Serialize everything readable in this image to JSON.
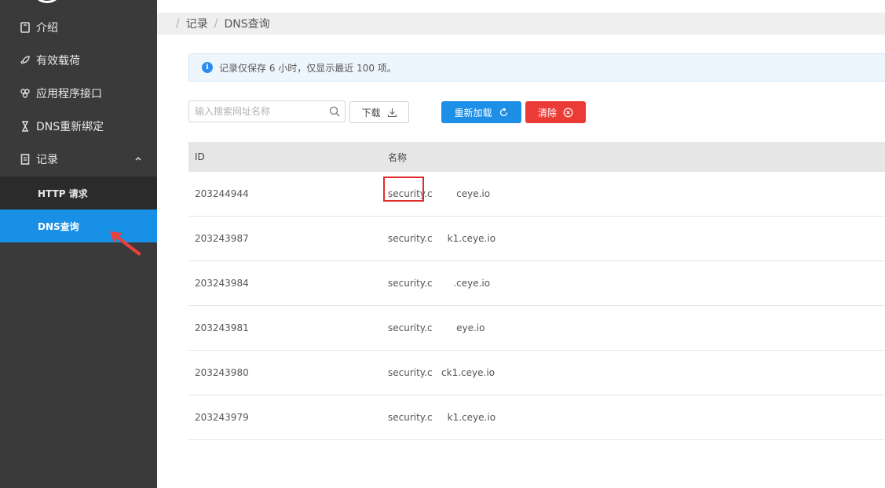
{
  "sidebar": {
    "items": [
      {
        "label": "介绍",
        "icon": "book-icon"
      },
      {
        "label": "有效载荷",
        "icon": "rocket-icon"
      },
      {
        "label": "应用程序接口",
        "icon": "api-icon"
      },
      {
        "label": "DNS重新绑定",
        "icon": "hourglass-icon"
      },
      {
        "label": "记录",
        "icon": "records-icon"
      }
    ],
    "subitems": [
      {
        "label": "HTTP 请求"
      },
      {
        "label": "DNS查询"
      }
    ]
  },
  "breadcrumb": {
    "items": [
      "记录",
      "DNS查询"
    ]
  },
  "alert": {
    "text": "记录仅保存 6 小时，仅显示最近 100 项。"
  },
  "toolbar": {
    "search_placeholder": "输入搜索网址名称",
    "download_label": "下载",
    "reload_label": "重新加载",
    "clear_label": "清除"
  },
  "table": {
    "columns": [
      "ID",
      "名称"
    ],
    "rows": [
      {
        "id": "203244944",
        "name": "security.c        ceye.io"
      },
      {
        "id": "203243987",
        "name": "security.c     k1.ceye.io"
      },
      {
        "id": "203243984",
        "name": "security.c       .ceye.io"
      },
      {
        "id": "203243981",
        "name": "security.c        eye.io"
      },
      {
        "id": "203243980",
        "name": "security.c   ck1.ceye.io"
      },
      {
        "id": "203243979",
        "name": "security.c     k1.ceye.io"
      }
    ]
  },
  "colors": {
    "sidebar_bg": "#3a3a3a",
    "active_bg": "#1890e6",
    "primary": "#1e8fe6",
    "danger": "#ec3b36",
    "annotation": "#e12b2b"
  }
}
